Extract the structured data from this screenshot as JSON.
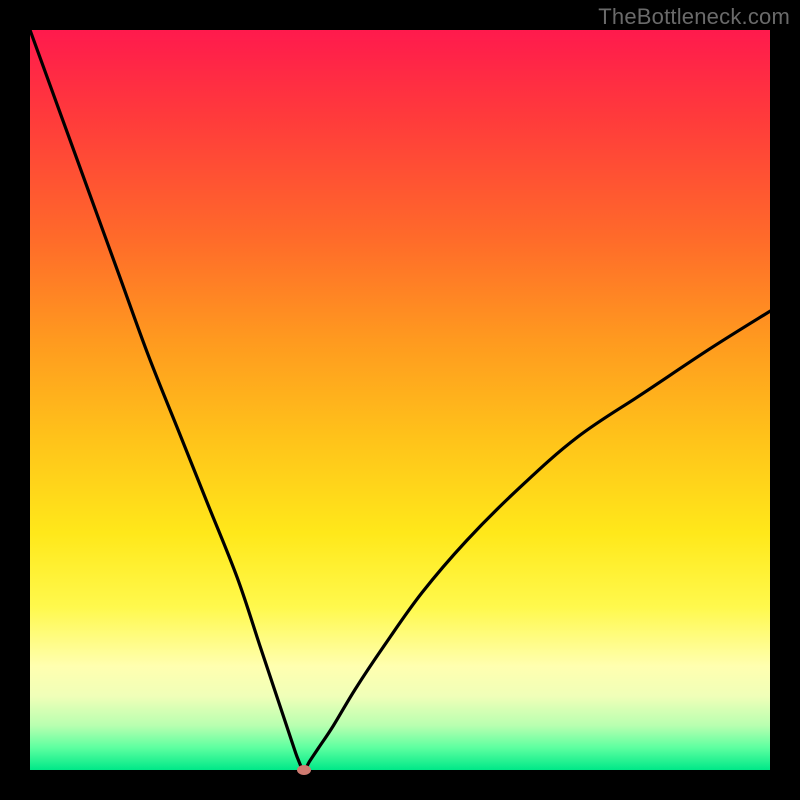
{
  "watermark": "TheBottleneck.com",
  "chart_data": {
    "type": "line",
    "title": "",
    "xlabel": "",
    "ylabel": "",
    "xlim": [
      0,
      100
    ],
    "ylim": [
      0,
      100
    ],
    "grid": false,
    "legend": false,
    "background_gradient": {
      "top": "#ff1a4d",
      "bottom": "#00e888"
    },
    "marker": {
      "x": 37,
      "y": 0,
      "color": "#cf7a70"
    },
    "series": [
      {
        "name": "bottleneck-curve",
        "color": "#000000",
        "x": [
          0,
          4,
          8,
          12,
          16,
          20,
          24,
          28,
          31,
          33,
          34.5,
          35.5,
          36.2,
          37,
          37.8,
          39,
          41,
          44,
          48,
          53,
          59,
          66,
          74,
          83,
          92,
          100
        ],
        "y": [
          100,
          89,
          78,
          67,
          56,
          46,
          36,
          26,
          17,
          11,
          6.5,
          3.5,
          1.5,
          0,
          1.2,
          3,
          6,
          11,
          17,
          24,
          31,
          38,
          45,
          51,
          57,
          62
        ]
      }
    ]
  }
}
